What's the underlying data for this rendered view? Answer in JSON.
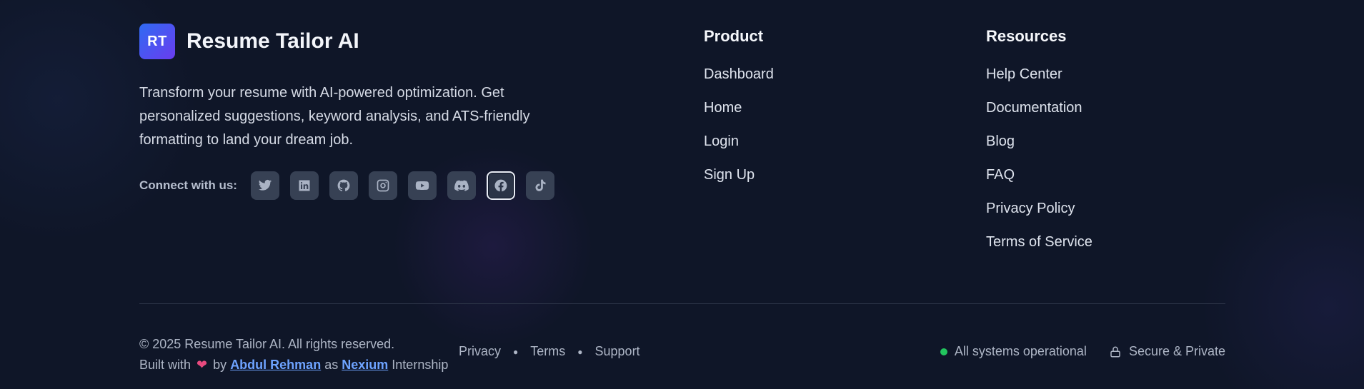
{
  "brand": {
    "logo_text": "RT",
    "name": "Resume Tailor AI"
  },
  "tagline": "Transform your resume with AI-powered optimization. Get personalized suggestions, keyword analysis, and ATS-friendly formatting to land your dream job.",
  "connect": {
    "label": "Connect with us:",
    "icons": [
      "twitter-icon",
      "linkedin-icon",
      "github-icon",
      "instagram-icon",
      "youtube-icon",
      "discord-icon",
      "facebook-icon",
      "tiktok-icon"
    ]
  },
  "product": {
    "title": "Product",
    "links": [
      "Dashboard",
      "Home",
      "Login",
      "Sign Up"
    ]
  },
  "resources": {
    "title": "Resources",
    "links": [
      "Help Center",
      "Documentation",
      "Blog",
      "FAQ",
      "Privacy Policy",
      "Terms of Service"
    ]
  },
  "footer": {
    "copyright": "© 2025 Resume Tailor AI. All rights reserved.",
    "built_with": "Built with",
    "by": "by",
    "author": "Abdul Rehman",
    "as": "as",
    "company": "Nexium",
    "internship": "Internship",
    "links": [
      "Privacy",
      "Terms",
      "Support"
    ],
    "status": "All systems operational",
    "secure": "Secure & Private"
  },
  "colors": {
    "accent": "#6ea3ff",
    "status_green": "#22c55e",
    "background": "#0f1628"
  }
}
